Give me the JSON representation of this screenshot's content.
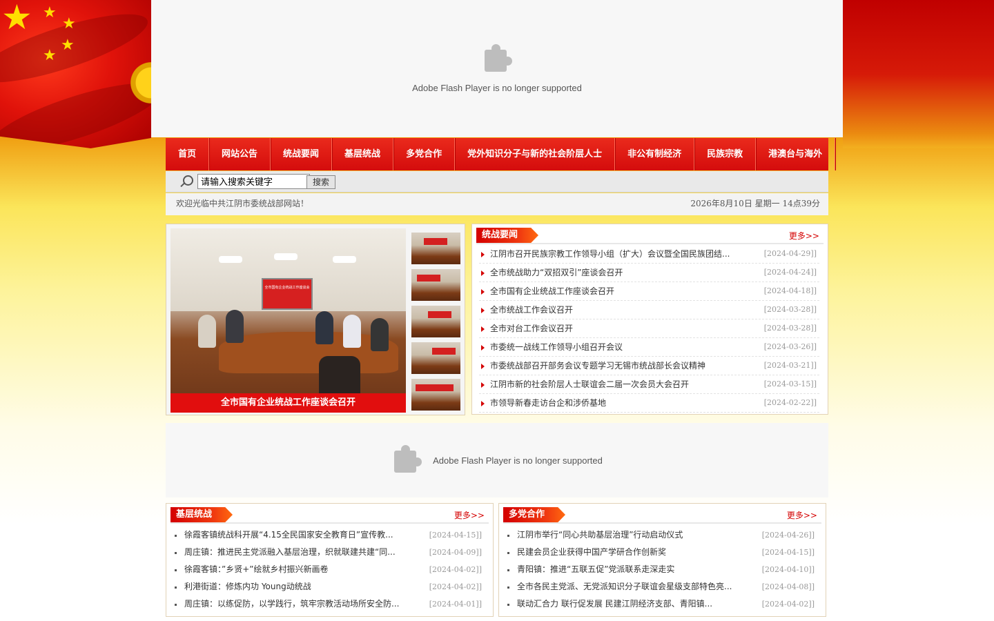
{
  "colors": {
    "accent": "#d40c0c",
    "gold": "#ffd21a"
  },
  "flash": {
    "message": "Adobe Flash Player is no longer supported"
  },
  "nav": {
    "items": [
      "首页",
      "网站公告",
      "统战要闻",
      "基层统战",
      "多党合作",
      "党外知识分子与新的社会阶层人士",
      "非公有制经济",
      "民族宗教",
      "港澳台与海外"
    ]
  },
  "search": {
    "value": "请输入搜索关键字",
    "button": "搜索"
  },
  "welcome": {
    "text": "欢迎光临中共江阴市委统战部网站！",
    "datetime": "2026年8月10日 星期一 14点39分"
  },
  "slider": {
    "caption": "全市国有企业统战工作座谈会召开",
    "screen_text": "全市国有企业统战工作座谈会"
  },
  "more_label": "更多>>",
  "zhanyaowen": {
    "title": "统战要闻",
    "items": [
      {
        "title": "江阴市召开民族宗教工作领导小组（扩大）会议暨全国民族团结...",
        "date": "[2024-04-29]]"
      },
      {
        "title": "全市统战助力“双招双引”座谈会召开",
        "date": "[2024-04-24]]"
      },
      {
        "title": "全市国有企业统战工作座谈会召开",
        "date": "[2024-04-18]]"
      },
      {
        "title": "全市统战工作会议召开",
        "date": "[2024-03-28]]"
      },
      {
        "title": "全市对台工作会议召开",
        "date": "[2024-03-28]]"
      },
      {
        "title": "市委统一战线工作领导小组召开会议",
        "date": "[2024-03-26]]"
      },
      {
        "title": "市委统战部召开部务会议专题学习无锡市统战部长会议精神",
        "date": "[2024-03-21]]"
      },
      {
        "title": "江阴市新的社会阶层人士联谊会二届一次会员大会召开",
        "date": "[2024-03-15]]"
      },
      {
        "title": "市领导新春走访台企和涉侨基地",
        "date": "[2024-02-22]]"
      }
    ]
  },
  "jiceng": {
    "title": "基层统战",
    "items": [
      {
        "title": "徐霞客镇统战科开展“4.15全民国家安全教育日”宣传教...",
        "date": "[2024-04-15]]"
      },
      {
        "title": "周庄镇：推进民主党派融入基层治理，织就联建共建“同...",
        "date": "[2024-04-09]]"
      },
      {
        "title": "徐霞客镇：”乡贤+”绘就乡村振兴新画卷",
        "date": "[2024-04-02]]"
      },
      {
        "title": "利港街道：修炼内功 Young动统战",
        "date": "[2024-04-02]]"
      },
      {
        "title": "周庄镇：以练促防，以学践行，筑牢宗教活动场所安全防...",
        "date": "[2024-04-01]]"
      }
    ]
  },
  "duodang": {
    "title": "多党合作",
    "items": [
      {
        "title": "江阴市举行“同心共助基层治理”行动启动仪式",
        "date": "[2024-04-26]]"
      },
      {
        "title": "民建会员企业获得中国产学研合作创新奖",
        "date": "[2024-04-15]]"
      },
      {
        "title": "青阳镇：推进“五联五促”党派联系走深走实",
        "date": "[2024-04-10]]"
      },
      {
        "title": "全市各民主党派、无党派知识分子联谊会星级支部特色亮...",
        "date": "[2024-04-08]]"
      },
      {
        "title": "联动汇合力 联行促发展 民建江阴经济支部、青阳镇...",
        "date": "[2024-04-02]]"
      }
    ]
  }
}
